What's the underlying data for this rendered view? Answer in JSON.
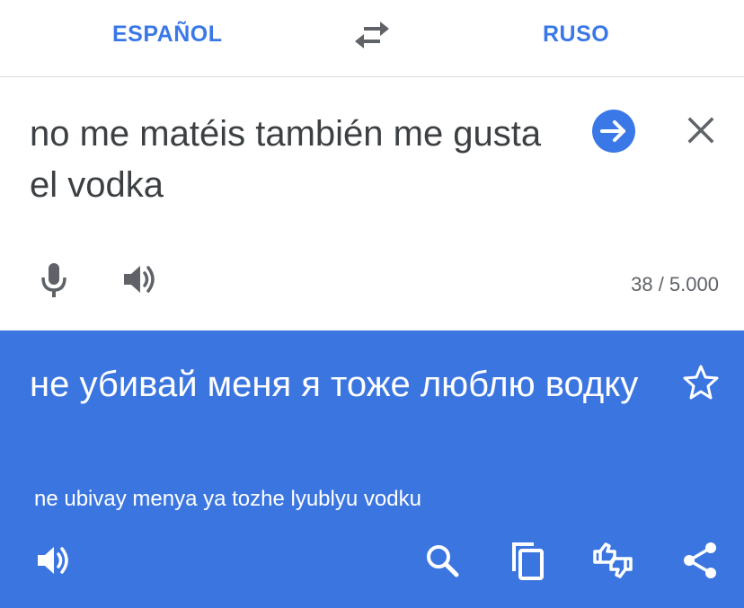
{
  "header": {
    "source_language": "ESPAÑOL",
    "target_language": "RUSO",
    "swap_icon": "swap-arrows-icon"
  },
  "input": {
    "text": "no me matéis también me gusta el vodka",
    "char_count": "38 / 5.000",
    "icons": [
      "arrow-right-circle-icon",
      "close-icon",
      "microphone-icon",
      "speaker-icon"
    ]
  },
  "output": {
    "translation": "не убивай меня я тоже люблю водку",
    "transliteration": "ne ubivay menya ya tozhe lyublyu vodku",
    "icons": [
      "star-icon",
      "speaker-icon",
      "search-icon",
      "copy-icon",
      "feedback-icon",
      "share-icon"
    ]
  },
  "colors": {
    "accent": "#3b78e7",
    "output_background": "#3b75e0",
    "icon_gray": "#5f6368",
    "text_dark": "#3c4043"
  }
}
